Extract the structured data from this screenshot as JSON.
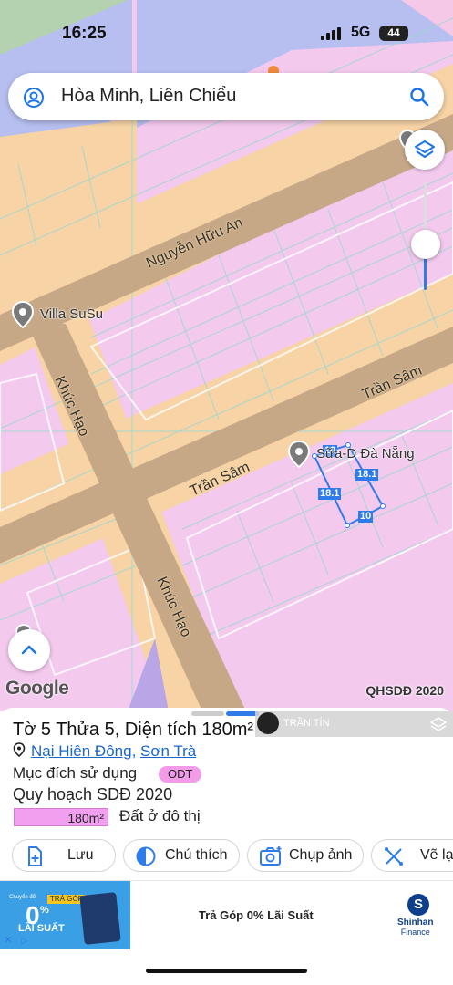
{
  "status": {
    "time": "16:25",
    "network": "5G",
    "battery": "44"
  },
  "search": {
    "query": "Hòa Minh, Liên Chiểu"
  },
  "map": {
    "places": [
      {
        "name": "Villa SuSu"
      },
      {
        "name": "Sữa-D Đà Nẵng"
      }
    ],
    "roads": [
      "Nguyễn Hữu An",
      "Trần Sâm",
      "Trần Sâm",
      "Khúc Hạo",
      "Khúc Hạo"
    ],
    "plot_dimensions": [
      "10",
      "18.1",
      "18.1",
      "10"
    ],
    "google_logo": "Google",
    "layer_label": "QHSDĐ 2020"
  },
  "watermark": {
    "text": "TRẦN TÍN"
  },
  "parcel": {
    "title": "Tờ 5 Thửa 5, Diện tích 180m²",
    "ward": "Nại Hiên Đông",
    "district": "Sơn Trà",
    "purpose_label": "Mục đích sử dụng",
    "purpose_code": "ODT",
    "plan_label": "Quy hoạch SDĐ 2020",
    "area_badge": "180m²",
    "area_desc": "Đất ở đô thị"
  },
  "actions": [
    {
      "label": "Lưu",
      "icon": "add-document-icon"
    },
    {
      "label": "Chú thích",
      "icon": "legend-icon"
    },
    {
      "label": "Chụp ảnh",
      "icon": "camera-icon"
    },
    {
      "label": "Vẽ lạ",
      "icon": "draw-icon"
    }
  ],
  "ad": {
    "thumb_small": "Chuyển đổi",
    "thumb_tag": "TRẢ GÓP",
    "thumb_percent": "0",
    "thumb_percent_sign": "%",
    "thumb_rate": "LÃI SUẤT",
    "headline": "Trả Góp 0% Lãi Suất",
    "brand_mark": "S",
    "brand_line1": "Shinhan",
    "brand_line2": "Finance"
  },
  "colors": {
    "residential": "#f3c9ee",
    "road": "#f5cf9e",
    "road_fill": "#c6a887",
    "accent": "#2f7be9",
    "badge": "#f29be9"
  }
}
